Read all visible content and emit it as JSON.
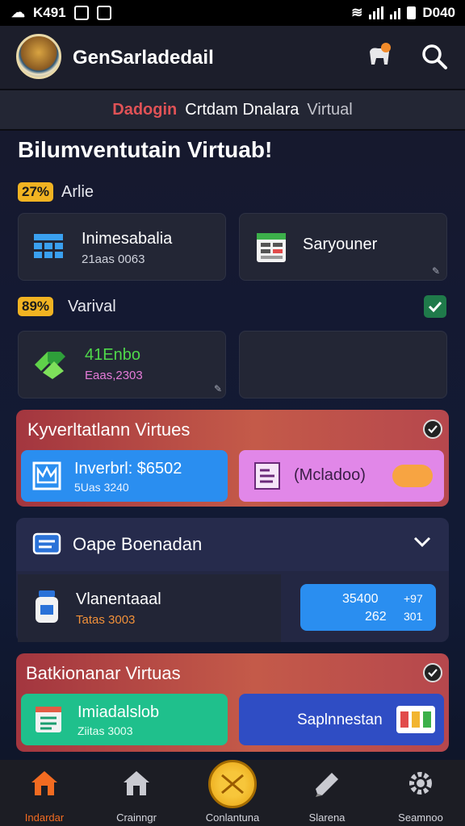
{
  "status_bar": {
    "left_text": "K491",
    "right_text": "D040"
  },
  "header": {
    "title": "GenSarladedail"
  },
  "tabs": {
    "t1": "Dadogin",
    "t2": "Crtdam Dnalara",
    "t3": "Virtual"
  },
  "page_title": "Bilumventutain Virtuab!",
  "section1": {
    "badge": "27%",
    "label": "Arlie",
    "card_a": {
      "title": "Inimesabalia",
      "sub": "21aas 0063"
    },
    "card_b": {
      "title": "Saryouner"
    }
  },
  "section2": {
    "badge": "89%",
    "label": "Varival",
    "card_a": {
      "title": "41Enbo",
      "sub": "Eaas,2303"
    }
  },
  "panel1": {
    "title": "Kyverltatlann Virtues",
    "btn_a": {
      "title": "Inverbrl: $6502",
      "sub": "5Uas 3240"
    },
    "btn_b": {
      "title": "(Mcladoo)"
    }
  },
  "panel2": {
    "title": "Oape Boenadan",
    "card": {
      "title": "Vlanentaaal",
      "sub": "Tatas 3003"
    },
    "stats": {
      "v1": "35400",
      "v2": "+97",
      "v3": "262",
      "v4": "301"
    }
  },
  "panel3": {
    "title": "Batkionanar Virtuas",
    "btn_a": {
      "title": "Imiadalslob",
      "sub": "Ziitas 3003"
    },
    "btn_b": {
      "title": "Saplnnestan"
    }
  },
  "bottom_nav": {
    "n1": "Indardar",
    "n2": "Crainngr",
    "n3": "Conlantuna",
    "n4": "Slarena",
    "n5": "Seamnoo"
  },
  "colors": {
    "accent_orange": "#f26b21",
    "accent_yellow": "#f1b322",
    "accent_green": "#1fc08c",
    "accent_blue": "#2a8ef0"
  }
}
